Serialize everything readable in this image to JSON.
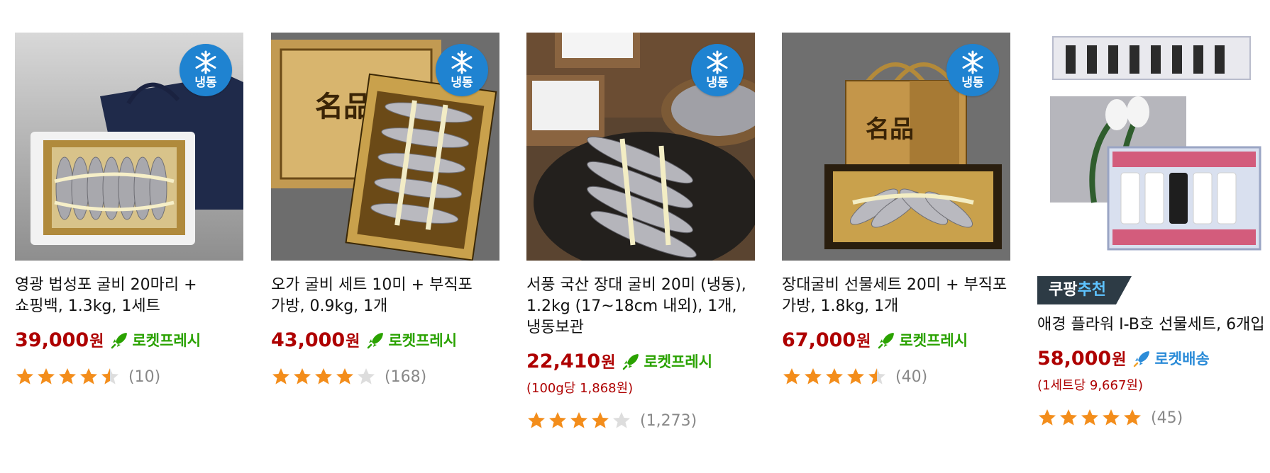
{
  "products": [
    {
      "name": "영광 법성포 굴비 20마리 + 쇼핑백, 1.3kg, 1세트",
      "price": "39,000",
      "currency": "원",
      "delivery": "로켓프레시",
      "delivery_type": "fresh",
      "frozen_label": "냉동",
      "unit_price": "",
      "rating": 4.5,
      "review_count": "(10)",
      "image": "fish-giftbox-navy-bag"
    },
    {
      "name": "오가 굴비 세트 10미 + 부직포 가방, 0.9kg, 1개",
      "price": "43,000",
      "currency": "원",
      "delivery": "로켓프레시",
      "delivery_type": "fresh",
      "frozen_label": "냉동",
      "unit_price": "",
      "rating": 4,
      "review_count": "(168)",
      "image": "fish-giftbox-gold"
    },
    {
      "name": "서풍 국산 장대 굴비 20미 (냉동), 1.2kg (17~18cm 내외), 1개, 냉동보관",
      "price": "22,410",
      "currency": "원",
      "delivery": "로켓프레시",
      "delivery_type": "fresh",
      "frozen_label": "냉동",
      "unit_price": "(100g당 1,868원)",
      "rating": 4,
      "review_count": "(1,273)",
      "image": "fish-plate-salt"
    },
    {
      "name": "장대굴비 선물세트 20미 + 부직포 가방, 1.8kg, 1개",
      "price": "67,000",
      "currency": "원",
      "delivery": "로켓프레시",
      "delivery_type": "fresh",
      "frozen_label": "냉동",
      "unit_price": "",
      "rating": 4.5,
      "review_count": "(40)",
      "image": "fish-giftbox-gold-bag"
    },
    {
      "name": "애경 플라워 I-B호 선물세트, 6개입",
      "price": "58,000",
      "currency": "원",
      "delivery": "로켓배송",
      "delivery_type": "normal",
      "badge_prefix": "쿠팡",
      "badge_highlight": "추천",
      "unit_price": "(1세트당 9,667원)",
      "rating": 5,
      "review_count": "(45)",
      "image": "shampoo-giftset"
    }
  ],
  "colors": {
    "price": "#ae0000",
    "rocket_fresh": "#2aa200",
    "rocket_delivery": "#2c8cd8",
    "star": "#f38d1b",
    "star_empty": "#dddddd",
    "frozen_badge": "#1f83d1",
    "recommend_badge": "#2d3b45"
  }
}
